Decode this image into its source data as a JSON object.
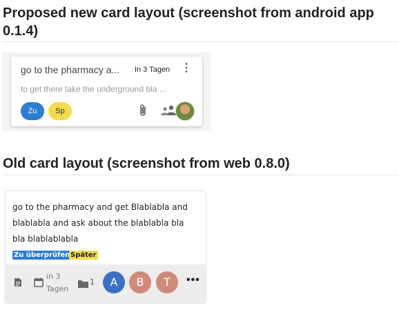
{
  "proposed": {
    "heading": "Proposed new card layout (screenshot from android app 0.1.4)",
    "card": {
      "title": "go to the pharmacy a...",
      "due": "In 3 Tagen",
      "description": "to get there take the underground bla ...",
      "labels": [
        {
          "text": "Zu",
          "color": "#2d7dd2"
        },
        {
          "text": "Sp",
          "color": "#f2dc4c"
        }
      ],
      "icons": [
        "more-vert-icon",
        "paperclip-icon",
        "people-icon",
        "user-photo-avatar"
      ]
    }
  },
  "old": {
    "heading": "Old card layout (screenshot from web 0.8.0)",
    "card": {
      "title": "go to the pharmacy and get Blablabla and blablabla and ask about the blablabla bla bla blablablabla",
      "tags": [
        {
          "text": "Zu überprüfen",
          "color": "#2d7dd2"
        },
        {
          "text": "Später",
          "color": "#f2dc4c"
        }
      ],
      "due": "in 3 Tagen",
      "attachment_count": "1",
      "avatars": [
        "A",
        "B",
        "T"
      ],
      "more": "•••",
      "icons": [
        "description-icon",
        "calendar-icon",
        "folder-icon"
      ]
    }
  }
}
